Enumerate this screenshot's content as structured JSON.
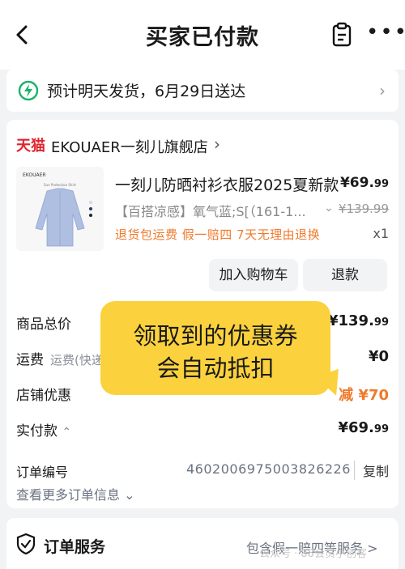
{
  "header": {
    "title": "买家已付款"
  },
  "shipping": {
    "text": "预计明天发货，6月29日送达"
  },
  "shop": {
    "platform": "天猫",
    "name": "EKOUAER一刻儿旗舰店",
    "logo_color": "#e0242c"
  },
  "product": {
    "image_brand": "EKOUAER",
    "image_caption": "Sun Protection Shirt",
    "title": "一刻儿防晒衬衫衣服2025夏新款",
    "price_main": "¥69.",
    "price_cents": "99",
    "sku": "【百搭凉感】氧气蓝;S[（161-1...",
    "original_price": "¥139.99",
    "services": "退货包运费  假一赔四  7天无理由退换",
    "quantity": "x1"
  },
  "actions": {
    "add_to_cart": "加入购物车",
    "refund": "退款"
  },
  "summary": {
    "goods_total_label": "商品总价",
    "goods_total_main": "¥139.",
    "goods_total_cents": "99",
    "shipping_label": "运费",
    "shipping_sub": "运费(快递",
    "shipping_value": "¥0",
    "shop_discount_label": "店铺优惠",
    "shop_discount_value": "减 ¥70",
    "paid_label": "实付款",
    "paid_main": "¥69.",
    "paid_cents": "99"
  },
  "order": {
    "number_label": "订单编号",
    "number": "4602006975003826226",
    "copy": "复制",
    "more_info": "查看更多订单信息"
  },
  "service": {
    "title": "订单服务",
    "note": "包含假一赔四等服务 >"
  },
  "callout": {
    "line1": "领取到的优惠券",
    "line2": "会自动抵扣",
    "color": "#fbd23d"
  },
  "watermark": "公众号 · 88会员小创客",
  "colors": {
    "accent_orange": "#f07a2c",
    "tmall_red": "#e0242c",
    "green": "#19b36b"
  }
}
